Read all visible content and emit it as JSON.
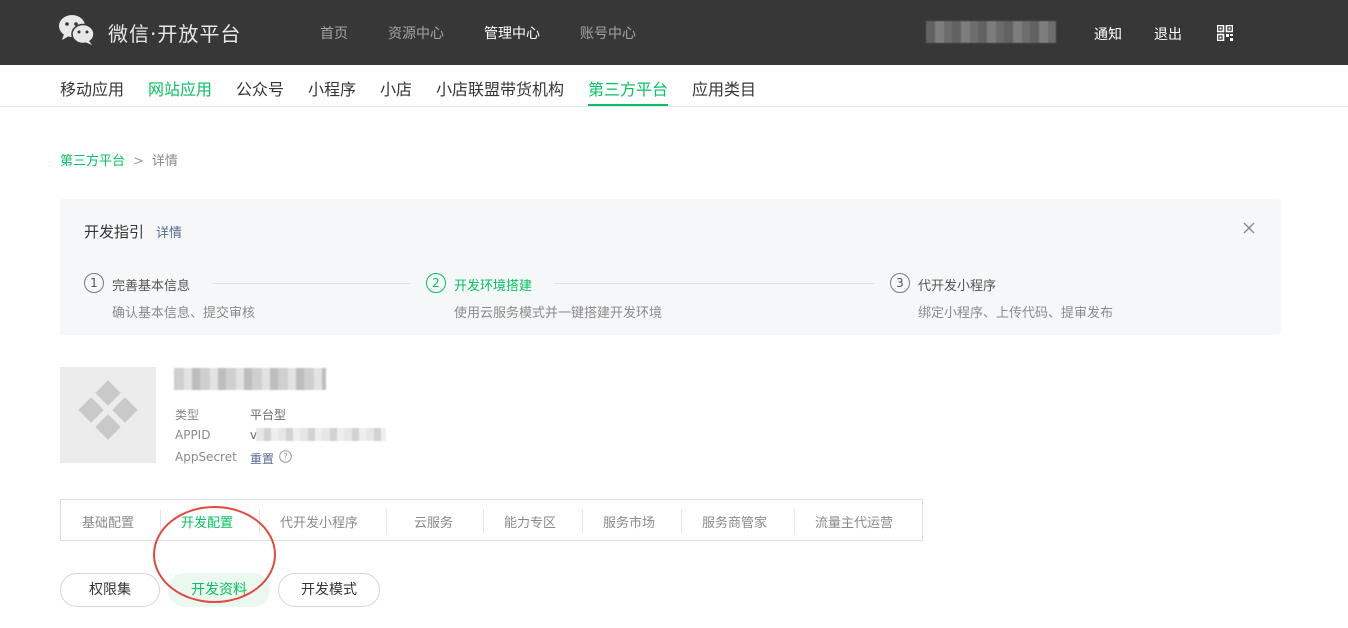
{
  "header": {
    "logo_text": "微信·开放平台",
    "nav": [
      "首页",
      "资源中心",
      "管理中心",
      "账号中心"
    ],
    "active_nav": "管理中心",
    "notice_label": "通知",
    "logout_label": "退出",
    "icons": [
      "wechat-logo-icon",
      "qr-code-icon"
    ]
  },
  "category_nav": {
    "items": [
      "移动应用",
      "网站应用",
      "公众号",
      "小程序",
      "小店",
      "小店联盟带货机构",
      "第三方平台",
      "应用类目"
    ],
    "active": "第三方平台"
  },
  "breadcrumb": {
    "parent": "第三方平台",
    "separator": ">",
    "current": "详情"
  },
  "guide": {
    "title": "开发指引",
    "detail_link": "详情",
    "steps": [
      {
        "num": "1",
        "title": "完善基本信息",
        "desc": "确认基本信息、提交审核"
      },
      {
        "num": "2",
        "title": "开发环境搭建",
        "desc": "使用云服务模式并一键搭建开发环境"
      },
      {
        "num": "3",
        "title": "代开发小程序",
        "desc": "绑定小程序、上传代码、提审发布"
      }
    ],
    "active_step": "2"
  },
  "app_info": {
    "type_label": "类型",
    "type_value": "平台型",
    "appid_label": "APPID",
    "appid_visible_prefix": "v",
    "secret_label": "AppSecret",
    "reset_link": "重置"
  },
  "tabs": {
    "items": [
      "基础配置",
      "开发配置",
      "代开发小程序",
      "云服务",
      "能力专区",
      "服务市场",
      "服务商管家",
      "流量主代运营"
    ],
    "active": "开发配置"
  },
  "sub_buttons": {
    "items": [
      "权限集",
      "开发资料",
      "开发模式"
    ],
    "active": "开发资料"
  },
  "colors": {
    "brand_green": "#07c160",
    "link_blue": "#576b95",
    "topbar": "#373737",
    "annotation_red": "#e04a3f"
  }
}
